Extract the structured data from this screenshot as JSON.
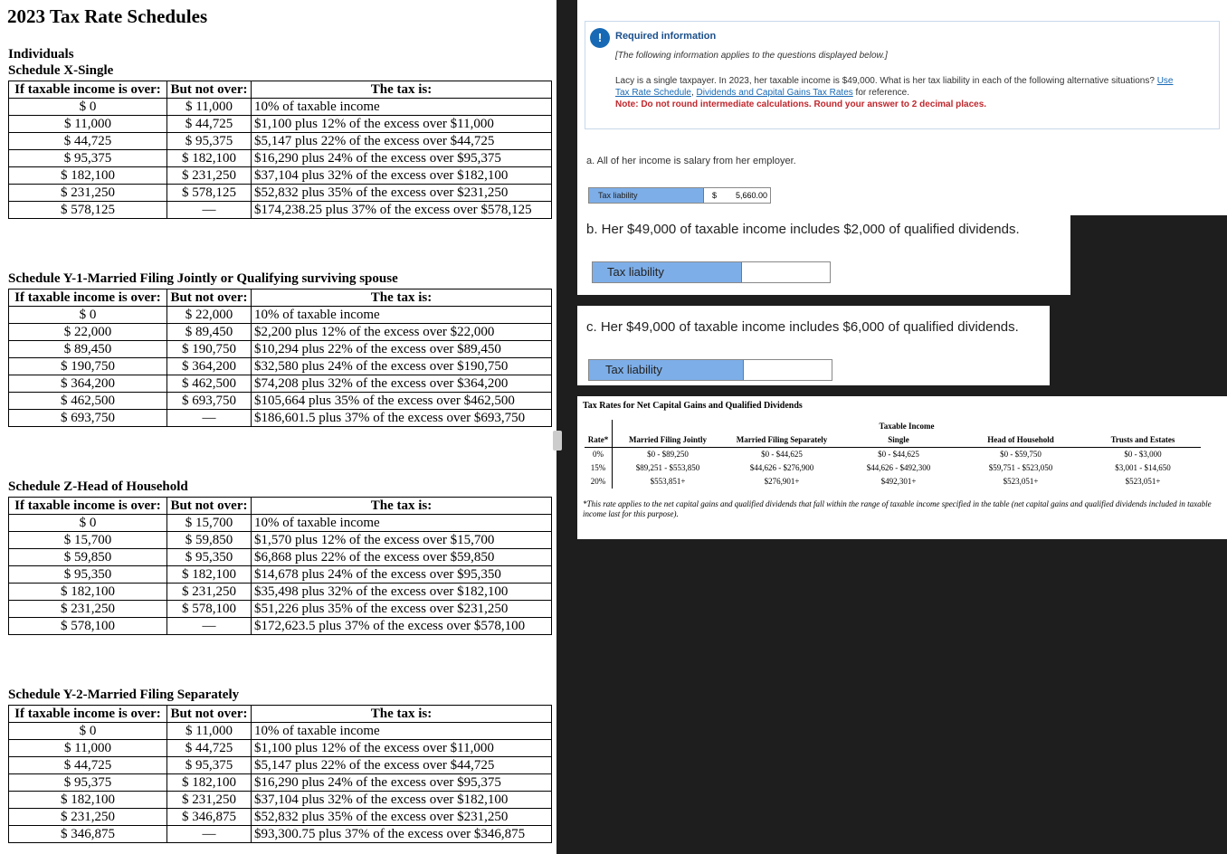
{
  "left": {
    "title": "2023 Tax Rate Schedules",
    "individuals_label": "Individuals",
    "columns": [
      "If taxable income is over:",
      "But not over:",
      "The tax is:"
    ],
    "schedules": [
      {
        "name": "Schedule X-Single",
        "rows": [
          [
            "$ 0",
            "$ 11,000",
            "10% of taxable income"
          ],
          [
            "$ 11,000",
            "$ 44,725",
            "$1,100 plus 12% of the excess over $11,000"
          ],
          [
            "$ 44,725",
            "$ 95,375",
            "$5,147 plus 22% of the excess over $44,725"
          ],
          [
            "$ 95,375",
            "$ 182,100",
            "$16,290 plus 24% of the excess over $95,375"
          ],
          [
            "$ 182,100",
            "$ 231,250",
            "$37,104 plus 32% of the excess over $182,100"
          ],
          [
            "$ 231,250",
            "$ 578,125",
            "$52,832 plus 35% of the excess over $231,250"
          ],
          [
            "$ 578,125",
            "—",
            "$174,238.25 plus 37% of the excess over $578,125"
          ]
        ]
      },
      {
        "name": "Schedule Y-1-Married Filing Jointly or Qualifying surviving spouse",
        "rows": [
          [
            "$ 0",
            "$ 22,000",
            "10% of taxable income"
          ],
          [
            "$ 22,000",
            "$ 89,450",
            "$2,200 plus 12% of the excess over $22,000"
          ],
          [
            "$ 89,450",
            "$ 190,750",
            "$10,294 plus 22% of the excess over $89,450"
          ],
          [
            "$ 190,750",
            "$ 364,200",
            "$32,580 plus 24% of the excess over $190,750"
          ],
          [
            "$ 364,200",
            "$ 462,500",
            "$74,208 plus 32% of the excess over $364,200"
          ],
          [
            "$ 462,500",
            "$ 693,750",
            "$105,664 plus 35% of the excess over $462,500"
          ],
          [
            "$ 693,750",
            "—",
            "$186,601.5 plus 37% of the excess over $693,750"
          ]
        ]
      },
      {
        "name": "Schedule Z-Head of Household",
        "rows": [
          [
            "$ 0",
            "$ 15,700",
            "10% of taxable income"
          ],
          [
            "$ 15,700",
            "$ 59,850",
            "$1,570 plus 12% of the excess over $15,700"
          ],
          [
            "$ 59,850",
            "$ 95,350",
            "$6,868 plus 22% of the excess over $59,850"
          ],
          [
            "$ 95,350",
            "$ 182,100",
            "$14,678 plus 24% of the excess over $95,350"
          ],
          [
            "$ 182,100",
            "$ 231,250",
            "$35,498 plus 32% of the excess over $182,100"
          ],
          [
            "$ 231,250",
            "$ 578,100",
            "$51,226 plus 35% of the excess over $231,250"
          ],
          [
            "$ 578,100",
            "—",
            "$172,623.5 plus 37% of the excess over $578,100"
          ]
        ]
      },
      {
        "name": "Schedule Y-2-Married Filing Separately",
        "rows": [
          [
            "$ 0",
            "$ 11,000",
            "10% of taxable income"
          ],
          [
            "$ 11,000",
            "$ 44,725",
            "$1,100 plus 12% of the excess over $11,000"
          ],
          [
            "$ 44,725",
            "$ 95,375",
            "$5,147 plus 22% of the excess over $44,725"
          ],
          [
            "$ 95,375",
            "$ 182,100",
            "$16,290 plus 24% of the excess over $95,375"
          ],
          [
            "$ 182,100",
            "$ 231,250",
            "$37,104 plus 32% of the excess over $182,100"
          ],
          [
            "$ 231,250",
            "$ 346,875",
            "$52,832 plus 35% of the excess over $231,250"
          ],
          [
            "$ 346,875",
            "—",
            "$93,300.75 plus 37% of the excess over $346,875"
          ]
        ]
      }
    ]
  },
  "question": {
    "alert_symbol": "!",
    "required_title": "Required information",
    "note": "[The following information applies to the questions displayed below.]",
    "body_text": "Lacy is a single taxpayer. In 2023, her taxable income is $49,000. What is her tax liability in each of the following alternative situations?",
    "link1": "Use Tax Rate Schedule",
    "link2": "Dividends and Capital Gains Tax Rates",
    "body_tail": "for reference.",
    "warning": "Note: Do not round intermediate calculations. Round your answer to 2 decimal places.",
    "parts": [
      {
        "text": "a. All of her income is salary from her employer.",
        "label": "Tax liability",
        "currency": "$",
        "value": "5,660.00"
      },
      {
        "text": "b. Her $49,000 of taxable income includes $2,000 of qualified dividends.",
        "label": "Tax liability",
        "value": ""
      },
      {
        "text": "c. Her $49,000 of taxable income includes $6,000 of qualified dividends.",
        "label": "Tax liability",
        "value": ""
      }
    ]
  },
  "capital_gains": {
    "title": "Tax Rates for Net Capital Gains and Qualified Dividends",
    "group_header": "Taxable Income",
    "headers": [
      "Rate*",
      "Married Filing Jointly",
      "Married Filing Separately",
      "Single",
      "Head of Household",
      "Trusts and Estates"
    ],
    "rows": [
      [
        "0%",
        "$0 - $89,250",
        "$0 - $44,625",
        "$0 - $44,625",
        "$0 - $59,750",
        "$0 - $3,000"
      ],
      [
        "15%",
        "$89,251 - $553,850",
        "$44,626 - $276,900",
        "$44,626 - $492,300",
        "$59,751 - $523,050",
        "$3,001 - $14,650"
      ],
      [
        "20%",
        "$553,851+",
        "$276,901+",
        "$492,301+",
        "$523,051+",
        "$523,051+"
      ]
    ],
    "footnote": "*This rate applies to the net capital gains and qualified dividends that fall within the range of taxable income specified in the table (net capital gains and qualified dividends included in taxable income last for this purpose)."
  }
}
